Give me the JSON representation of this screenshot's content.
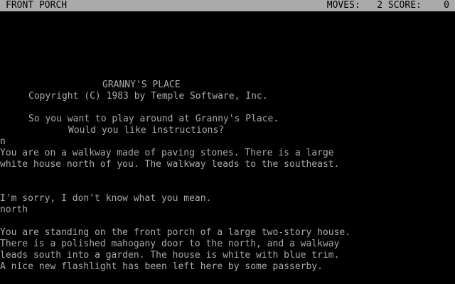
{
  "status_bar": {
    "location": "FRONT PORCH",
    "moves_label": "MOVES:",
    "moves_value": "2",
    "score_label": "SCORE:",
    "score_value": "0"
  },
  "transcript": {
    "title": "GRANNY'S PLACE",
    "copyright": "Copyright (C) 1983 by Temple Software, Inc.",
    "intro_question": "So you want to play around at Granny's Place.",
    "instructions_question": "Would you like instructions?",
    "input_1": "n",
    "walkway_desc_1": "You are on a walkway made of paving stones. There is a large",
    "walkway_desc_2": "white house north of you. The walkway leads to the southeast.",
    "error_message": "I'm sorry, I don't know what you mean.",
    "input_2": "north",
    "porch_desc_1": "You are standing on the front porch of a large two-story house.",
    "porch_desc_2": "There is a polished mahogany door to the north, and a walkway",
    "porch_desc_3": "leads south into a garden. The house is white with blue trim.",
    "porch_desc_4": "A nice new flashlight has been left here by some passerby."
  },
  "colors": {
    "status_bar_background": "#aaaaaa",
    "status_bar_text": "#000000",
    "screen_background": "#000000",
    "screen_text": "#aaaaaa"
  }
}
